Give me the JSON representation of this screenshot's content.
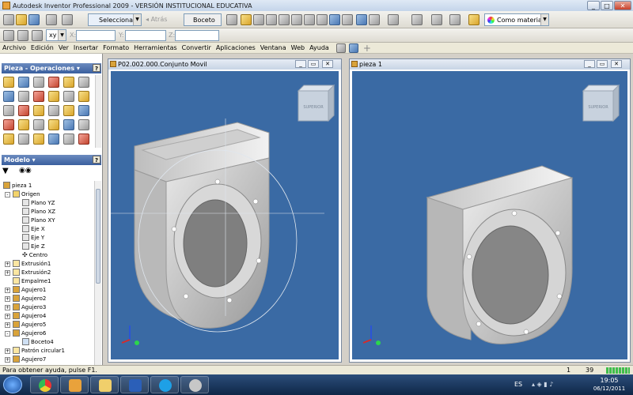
{
  "window": {
    "title": "Autodesk Inventor Professional 2009 - VERSIÓN INSTITUCIONAL EDUCATIVA"
  },
  "toolbar": {
    "select_label": "Seleccionar",
    "back_label": "Atrás",
    "sketch_label": "Boceto",
    "material_label": "Como material"
  },
  "coords": {
    "plane_value": "xy",
    "x_label": "X:",
    "y_label": "Y:",
    "z_label": "Z:"
  },
  "menu": [
    "Archivo",
    "Edición",
    "Ver",
    "Insertar",
    "Formato",
    "Herramientas",
    "Convertir",
    "Aplicaciones",
    "Ventana",
    "Web",
    "Ayuda"
  ],
  "panels": {
    "features_title": "Pieza - Operaciones",
    "model_title": "Modelo",
    "help_glyph": "?"
  },
  "tree": [
    {
      "label": "pieza 1",
      "level": 0,
      "icon": "part"
    },
    {
      "label": "Origen",
      "level": 1,
      "icon": "folder",
      "toggle": "-"
    },
    {
      "label": "Plano YZ",
      "level": 2,
      "icon": "plane"
    },
    {
      "label": "Plano XZ",
      "level": 2,
      "icon": "plane"
    },
    {
      "label": "Plano XY",
      "level": 2,
      "icon": "plane"
    },
    {
      "label": "Eje X",
      "level": 2,
      "icon": "plane"
    },
    {
      "label": "Eje Y",
      "level": 2,
      "icon": "plane"
    },
    {
      "label": "Eje Z",
      "level": 2,
      "icon": "plane"
    },
    {
      "label": "Centro",
      "level": 2,
      "icon": "plane"
    },
    {
      "label": "Extrusión1",
      "level": 1,
      "icon": "extrude",
      "toggle": "+"
    },
    {
      "label": "Extrusión2",
      "level": 1,
      "icon": "extrude",
      "toggle": "+"
    },
    {
      "label": "Empalme1",
      "level": 1,
      "icon": "extrude"
    },
    {
      "label": "Agujero1",
      "level": 1,
      "icon": "hole",
      "toggle": "+"
    },
    {
      "label": "Agujero2",
      "level": 1,
      "icon": "hole",
      "toggle": "+"
    },
    {
      "label": "Agujero3",
      "level": 1,
      "icon": "hole",
      "toggle": "+"
    },
    {
      "label": "Agujero4",
      "level": 1,
      "icon": "hole",
      "toggle": "+"
    },
    {
      "label": "Agujero5",
      "level": 1,
      "icon": "hole",
      "toggle": "+"
    },
    {
      "label": "Agujero6",
      "level": 1,
      "icon": "hole",
      "toggle": "-"
    },
    {
      "label": "Boceto4",
      "level": 2,
      "icon": "sketch"
    },
    {
      "label": "Patrón circular1",
      "level": 1,
      "icon": "extrude",
      "toggle": "+"
    },
    {
      "label": "Agujero7",
      "level": 1,
      "icon": "hole",
      "toggle": "+"
    }
  ],
  "documents": [
    {
      "title": "P02.002.000.Conjunto Movil"
    },
    {
      "title": "pieza 1"
    }
  ],
  "viewcube_label": "SUPERIOR",
  "status": {
    "help": "Para obtener ayuda, pulse F1.",
    "count1": "1",
    "count2": "39"
  },
  "taskbar": {
    "lang": "ES",
    "time": "19:05",
    "date": "06/12/2011"
  },
  "colors": {
    "viewport": "#3a6aa4",
    "titlebar": "#c4d5ea",
    "taskbar": "#1c3a63"
  }
}
